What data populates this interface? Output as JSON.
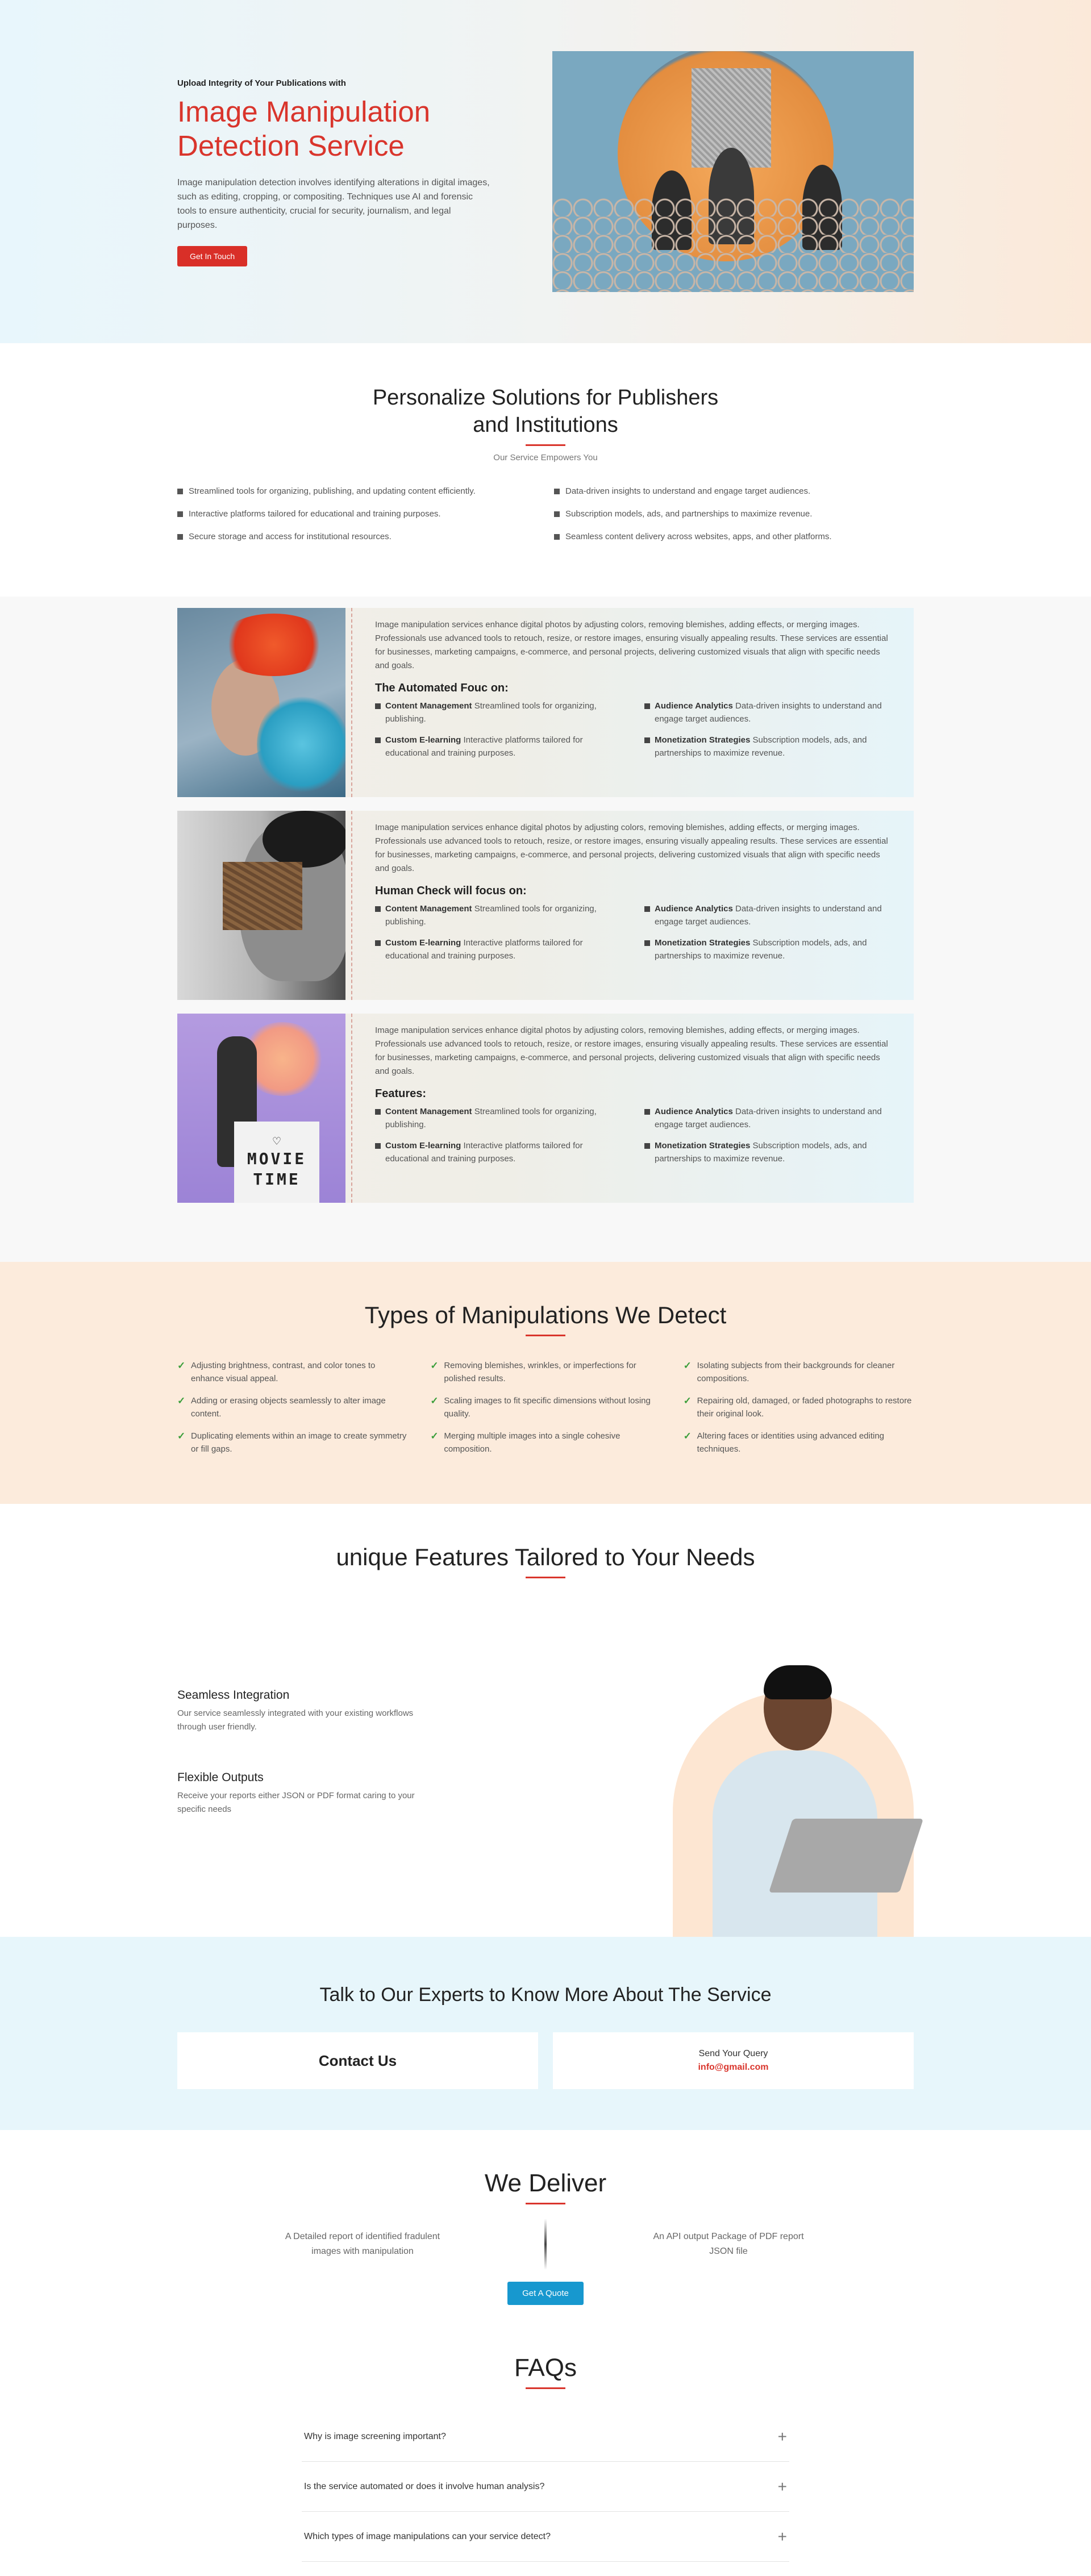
{
  "hero": {
    "kicker": "Upload Integrity of Your Publications with",
    "title": "Image Manipulation Detection Service",
    "description": "Image manipulation detection involves identifying alterations in digital images, such as editing, cropping, or compositing. Techniques use AI and forensic tools to ensure authenticity, crucial for security, journalism, and legal purposes.",
    "cta": "Get In Touch"
  },
  "personalize": {
    "title": "Personalize Solutions for Publishers and Institutions",
    "subtitle": "Our Service Empowers You",
    "items": [
      "Streamlined tools for organizing, publishing, and updating content efficiently.",
      "Data-driven insights to understand and engage target audiences.",
      "Interactive platforms tailored for educational and training purposes.",
      "Subscription models, ads, and partnerships to maximize revenue.",
      "Secure storage and access for institutional resources.",
      "Seamless content delivery across websites, apps, and other platforms."
    ]
  },
  "cards": [
    {
      "description": "Image manipulation services enhance digital photos by adjusting colors, removing blemishes, adding effects, or merging images. Professionals use advanced tools to retouch, resize, or restore images, ensuring visually appealing results. These services are essential for businesses, marketing campaigns, e-commerce, and personal projects, delivering customized visuals that align with specific needs and goals.",
      "heading": "The Automated Fouc on:",
      "features": [
        {
          "title": "Content Management",
          "text": "Streamlined tools for organizing, publishing."
        },
        {
          "title": "Audience Analytics",
          "text": "Data-driven insights to understand and engage target audiences."
        },
        {
          "title": "Custom E-learning",
          "text": "Interactive platforms tailored for educational and training purposes."
        },
        {
          "title": "Monetization Strategies",
          "text": "Subscription models, ads, and partnerships to maximize revenue."
        }
      ]
    },
    {
      "description": "Image manipulation services enhance digital photos by adjusting colors, removing blemishes, adding effects, or merging images. Professionals use advanced tools to retouch, resize, or restore images, ensuring visually appealing results. These services are essential for businesses, marketing campaigns, e-commerce, and personal projects, delivering customized visuals that align with specific needs and goals.",
      "heading": "Human Check will focus on:",
      "features": [
        {
          "title": "Content Management",
          "text": "Streamlined tools for organizing, publishing."
        },
        {
          "title": "Audience Analytics",
          "text": "Data-driven insights to understand and engage target audiences."
        },
        {
          "title": "Custom E-learning",
          "text": "Interactive platforms tailored for educational and training purposes."
        },
        {
          "title": "Monetization Strategies",
          "text": "Subscription models, ads, and partnerships to maximize revenue."
        }
      ]
    },
    {
      "description": "Image manipulation services enhance digital photos by adjusting colors, removing blemishes, adding effects, or merging images. Professionals use advanced tools to retouch, resize, or restore images, ensuring visually appealing results. These services are essential for businesses, marketing campaigns, e-commerce, and personal projects, delivering customized visuals that align with specific needs and goals.",
      "heading": "Features:",
      "features": [
        {
          "title": "Content Management",
          "text": "Streamlined tools for organizing, publishing."
        },
        {
          "title": "Audience Analytics",
          "text": "Data-driven insights to understand and engage target audiences."
        },
        {
          "title": "Custom E-learning",
          "text": "Interactive platforms tailored for educational and training purposes."
        },
        {
          "title": "Monetization Strategies",
          "text": "Subscription models, ads, and partnerships to maximize revenue."
        }
      ],
      "image_text": "MOVIE TIME"
    }
  ],
  "types": {
    "title": "Types of Manipulations We Detect",
    "items": [
      "Adjusting brightness, contrast, and color tones to enhance visual appeal.",
      "Removing blemishes, wrinkles, or imperfections for polished results.",
      "Isolating subjects from their backgrounds for cleaner compositions.",
      "Adding or erasing objects seamlessly to alter image content.",
      "Scaling images to fit specific dimensions without losing quality.",
      "Repairing old, damaged, or faded photographs to restore their original look.",
      "Duplicating elements within an image to create symmetry or fill gaps.",
      "Merging multiple images into a single cohesive composition.",
      "Altering faces or identities using advanced editing techniques."
    ]
  },
  "unique": {
    "title": "unique Features Tailored to Your Needs",
    "items": [
      {
        "title": "Seamless Integration",
        "text": "Our service seamlessly integrated with your existing workflows through user friendly."
      },
      {
        "title": "Flexible Outputs",
        "text": "Receive your reports either JSON or PDF format caring to your specific needs"
      }
    ]
  },
  "talk": {
    "title": "Talk to Our Experts to Know More About The Service",
    "contact": "Contact Us",
    "query_label": "Send Your Query",
    "email": "info@gmail.com"
  },
  "deliver": {
    "title": "We Deliver",
    "left": "A Detailed report of identified fradulent images with manipulation",
    "right": "An API output Package of PDF report JSON file",
    "cta": "Get A Quote"
  },
  "faq": {
    "title": "FAQs",
    "items": [
      "Why is image screening important?",
      "Is the service automated or does it involve human analysis?",
      "Which types of image manipulations can your service detect?"
    ]
  },
  "colors": {
    "accent_red": "#d9352c",
    "accent_blue": "#1798cf",
    "peach": "#fcebdc",
    "light_blue": "#e7f6fb"
  }
}
